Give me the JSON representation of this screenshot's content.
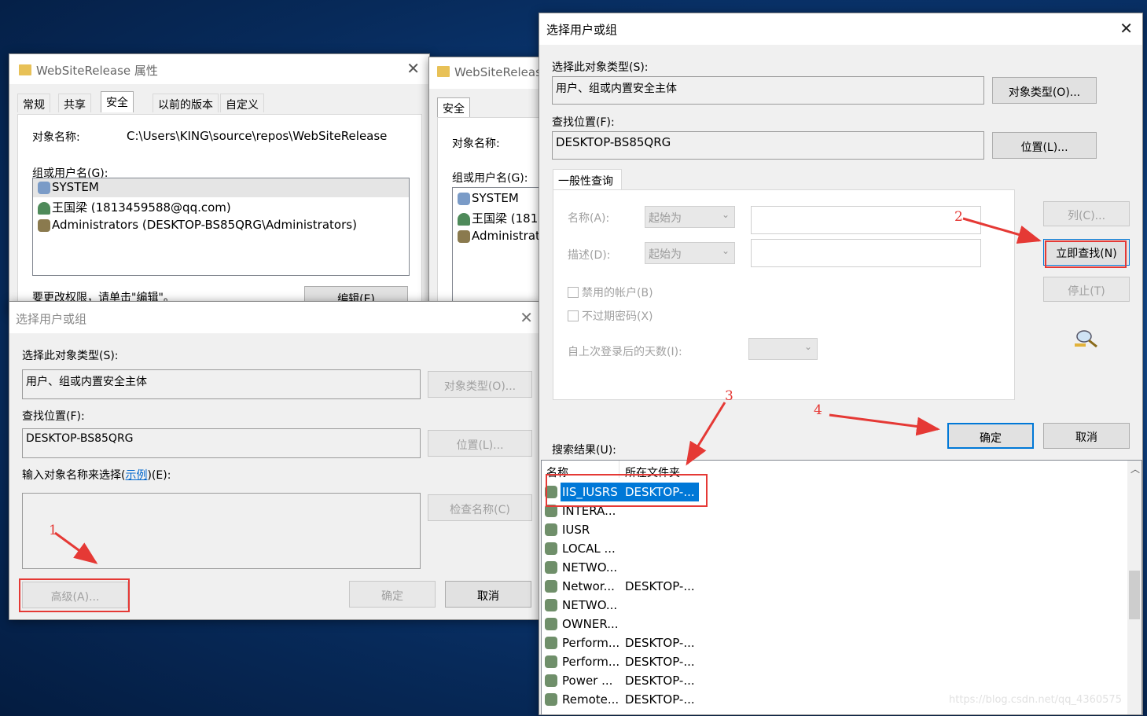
{
  "props_win": {
    "title": "WebSiteRelease 属性",
    "tabs": [
      "常规",
      "共享",
      "安全",
      "以前的版本",
      "自定义"
    ],
    "object_label": "对象名称:",
    "object_value": "C:\\Users\\KING\\source\\repos\\WebSiteRelease",
    "group_label": "组或用户名(G):",
    "users": [
      "SYSTEM",
      "王国梁 (1813459588@qq.com)",
      "Administrators (DESKTOP-BS85QRG\\Administrators)"
    ],
    "edit_hint": "要更改权限，请单击\"编辑\"。",
    "edit_button": "编辑(E)"
  },
  "props_win2": {
    "title": "WebSiteReleas",
    "tab": "安全",
    "object_label": "对象名称:",
    "group_label": "组或用户名(G):",
    "users": [
      "SYSTEM",
      "王国梁 (181",
      "Administrat"
    ]
  },
  "small_dialog": {
    "title": "选择用户或组",
    "obj_type_label": "选择此对象类型(S):",
    "obj_type_value": "用户、组或内置安全主体",
    "obj_type_button": "对象类型(O)...",
    "location_label": "查找位置(F):",
    "location_value": "DESKTOP-BS85QRG",
    "location_button": "位置(L)...",
    "enter_label_pre": "输入对象名称来选择(",
    "enter_label_link": "示例",
    "enter_label_post": ")(E):",
    "check_button": "检查名称(C)",
    "advanced_button": "高级(A)...",
    "ok_button": "确定",
    "cancel_button": "取消"
  },
  "main_dialog": {
    "title": "选择用户或组",
    "obj_type_label": "选择此对象类型(S):",
    "obj_type_value": "用户、组或内置安全主体",
    "obj_type_button": "对象类型(O)...",
    "location_label": "查找位置(F):",
    "location_value": "DESKTOP-BS85QRG",
    "location_button": "位置(L)...",
    "tab": "一般性查询",
    "name_label": "名称(A):",
    "name_combo": "起始为",
    "desc_label": "描述(D):",
    "desc_combo": "起始为",
    "disabled_accounts": "禁用的帐户(B)",
    "non_expiring": "不过期密码(X)",
    "days_label": "自上次登录后的天数(I):",
    "columns_button": "列(C)...",
    "find_now_button": "立即查找(N)",
    "stop_button": "停止(T)",
    "ok_button": "确定",
    "cancel_button": "取消",
    "results_label": "搜索结果(U):",
    "col_name": "名称",
    "col_folder": "所在文件夹",
    "results": [
      {
        "name": "IIS_IUSRS",
        "folder": "DESKTOP-..."
      },
      {
        "name": "INTERA...",
        "folder": ""
      },
      {
        "name": "IUSR",
        "folder": ""
      },
      {
        "name": "LOCAL ...",
        "folder": ""
      },
      {
        "name": "NETWO...",
        "folder": ""
      },
      {
        "name": "Networ...",
        "folder": "DESKTOP-..."
      },
      {
        "name": "NETWO...",
        "folder": ""
      },
      {
        "name": "OWNER...",
        "folder": ""
      },
      {
        "name": "Perform...",
        "folder": "DESKTOP-..."
      },
      {
        "name": "Perform...",
        "folder": "DESKTOP-..."
      },
      {
        "name": "Power ...",
        "folder": "DESKTOP-..."
      },
      {
        "name": "Remote...",
        "folder": "DESKTOP-..."
      }
    ]
  },
  "annotations": [
    "1",
    "2",
    "3",
    "4"
  ],
  "watermark": "https://blog.csdn.net/qq_4360575",
  "colors": {
    "annotation": "#e53935",
    "selection": "#0078d7"
  }
}
